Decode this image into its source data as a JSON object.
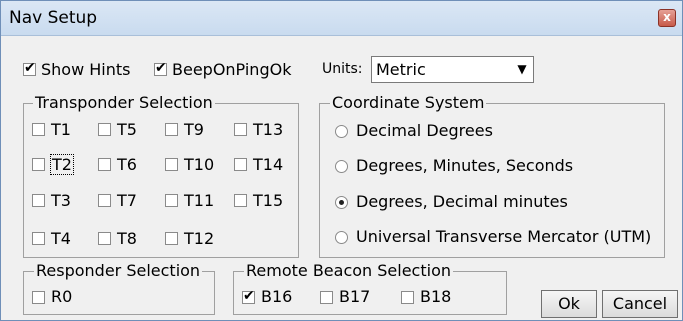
{
  "window": {
    "title": "Nav Setup",
    "close_glyph": "x"
  },
  "top": {
    "show_hints": {
      "label": "Show Hints",
      "checked": true
    },
    "beep": {
      "label": "BeepOnPingOk",
      "checked": true
    },
    "units_label": "Units:",
    "units_value": "Metric",
    "units_arrow": "▼"
  },
  "transponder": {
    "legend": "Transponder Selection",
    "items": [
      "T1",
      "T5",
      "T9",
      "T13",
      "T2",
      "T6",
      "T10",
      "T14",
      "T3",
      "T7",
      "T11",
      "T15",
      "T4",
      "T8",
      "T12"
    ]
  },
  "coordinate": {
    "legend": "Coordinate System",
    "options": [
      {
        "label": "Decimal Degrees",
        "selected": false
      },
      {
        "label": "Degrees, Minutes, Seconds",
        "selected": false
      },
      {
        "label": "Degrees, Decimal minutes",
        "selected": true
      },
      {
        "label": "Universal Transverse Mercator (UTM)",
        "selected": false
      }
    ]
  },
  "responder": {
    "legend": "Responder Selection",
    "items": [
      "R0"
    ]
  },
  "beacon": {
    "legend": "Remote Beacon Selection",
    "items": [
      {
        "label": "B16",
        "checked": true
      },
      {
        "label": "B17",
        "checked": false
      },
      {
        "label": "B18",
        "checked": false
      }
    ]
  },
  "buttons": {
    "ok": "Ok",
    "cancel": "Cancel"
  }
}
